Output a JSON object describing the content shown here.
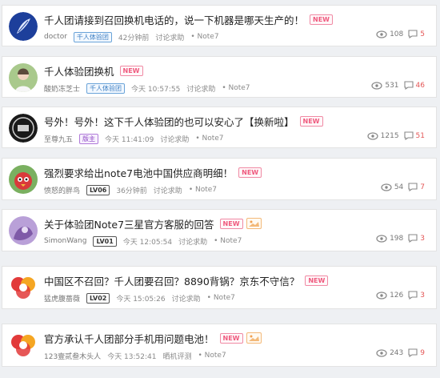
{
  "posts": [
    {
      "title": "千人团请接到召回换机电话的，说一下机器是哪天生产的！",
      "new_badge": "NEW",
      "author": "doctor",
      "role": "千人体验团",
      "time": "42分钟前",
      "category": "讨论求助",
      "board": "• Note7",
      "views": "108",
      "replies": "5",
      "avatar": "feather-avatar",
      "has_image_badge": false
    },
    {
      "title": "千人体验团换机",
      "new_badge": "NEW",
      "author": "酸奶冻芝士",
      "role": "千人体验团",
      "time": "今天 10:57:55",
      "category": "讨论求助",
      "board": "• Note7",
      "views": "531",
      "replies": "46",
      "avatar": "person-avatar",
      "has_image_badge": false
    },
    {
      "title": "号外！号外！这下千人体验团的也可以安心了【换新啦】",
      "new_badge": "NEW",
      "author": "至尊九五",
      "role": "版主",
      "time": "今天 11:41:09",
      "category": "讨论求助",
      "board": "• Note7",
      "views": "1215",
      "replies": "51",
      "avatar": "emblem-avatar",
      "has_image_badge": false
    },
    {
      "title": "强烈要求给出note7电池中国供应商明细！",
      "new_badge": "NEW",
      "author": "愤怒的胖鸟",
      "role": "LV06",
      "time": "36分钟前",
      "category": "讨论求助",
      "board": "• Note7",
      "views": "54",
      "replies": "7",
      "avatar": "bird-avatar",
      "has_image_badge": false
    },
    {
      "title": "关于体验团Note7三星官方客服的回答",
      "new_badge": "NEW",
      "author": "SimonWang",
      "role": "LV01",
      "time": "今天 12:05:54",
      "category": "讨论求助",
      "board": "• Note7",
      "views": "198",
      "replies": "3",
      "avatar": "purple-avatar",
      "has_image_badge": true
    },
    {
      "title": "中国区不召回？千人团要召回？8890背锅？京东不守信？",
      "new_badge": "NEW",
      "author": "猛虎腹蔷薇",
      "role": "LV02",
      "time": "今天 15:05:26",
      "category": "讨论求助",
      "board": "• Note7",
      "views": "126",
      "replies": "3",
      "avatar": "logo-avatar",
      "has_image_badge": false
    },
    {
      "title": "官方承认千人团部分手机用问题电池！",
      "new_badge": "NEW",
      "author": "123壹贰叁木头人",
      "role": "",
      "time": "今天 13:52:41",
      "category": "晒机评测",
      "board": "• Note7",
      "views": "243",
      "replies": "9",
      "avatar": "logo-avatar",
      "has_image_badge": true
    }
  ],
  "colors": {
    "new": "#ef5a7e",
    "reply": "#e45757",
    "rank": "#3a7dc2"
  }
}
